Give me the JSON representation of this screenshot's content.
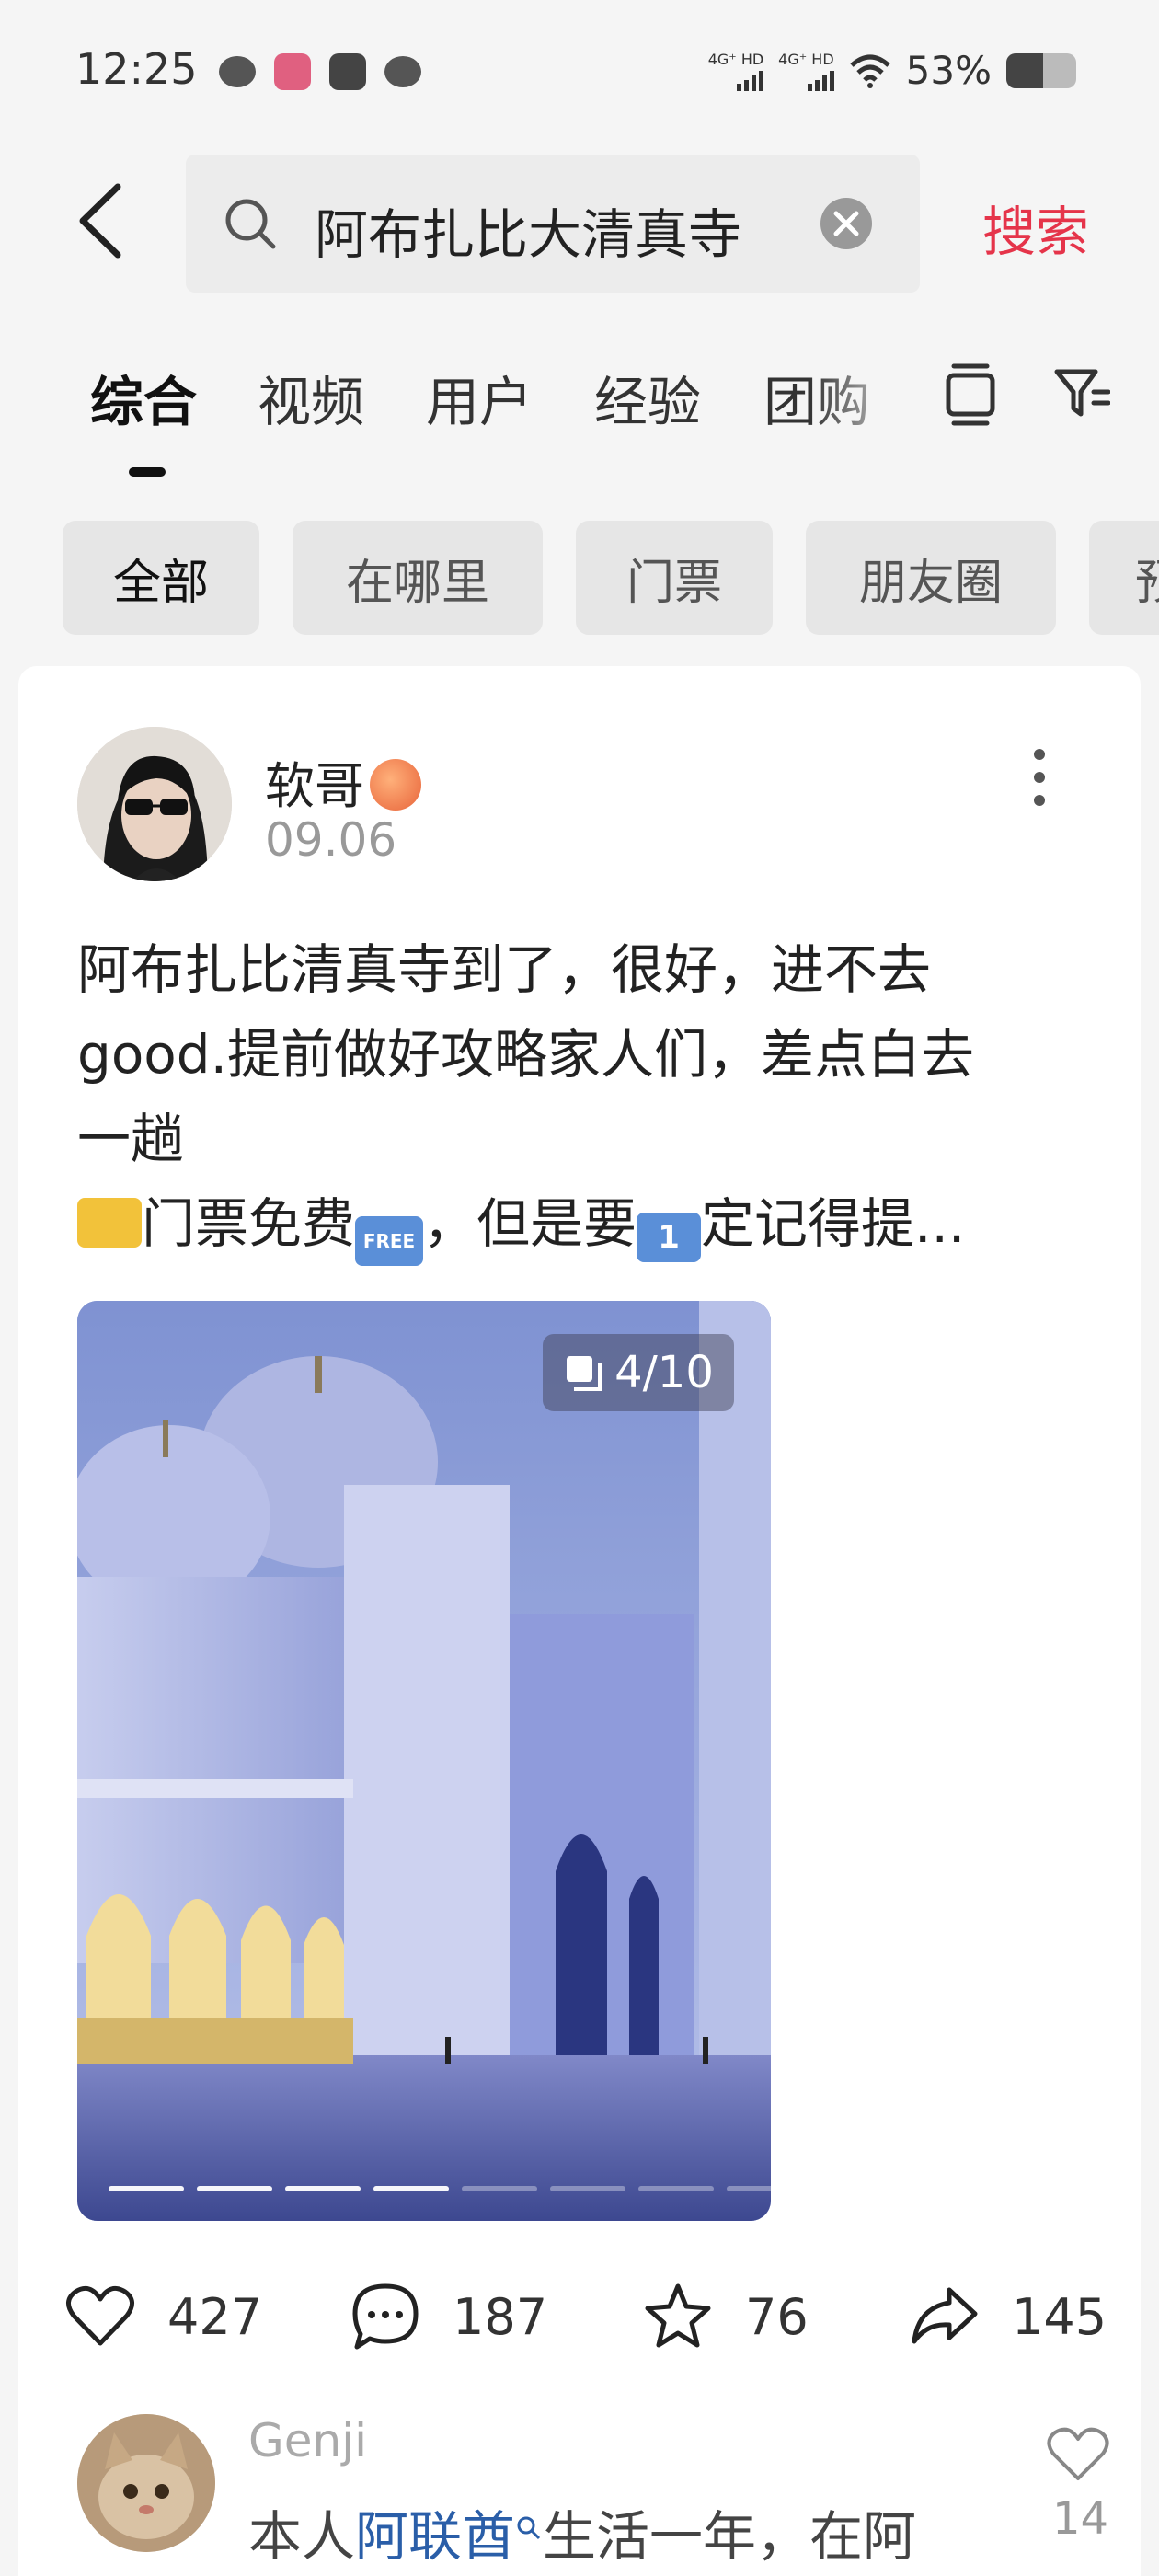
{
  "status_bar": {
    "time": "12:25",
    "network_1": "4G⁺ HD",
    "network_2": "4G⁺ HD",
    "battery_percent": "53%",
    "battery_level": 0.53,
    "left_icons": [
      "wechat-icon",
      "bilibili-icon",
      "box-icon",
      "message-icon"
    ]
  },
  "search": {
    "query": "阿布扎比大清真寺",
    "submit_label": "搜索"
  },
  "tabs": [
    {
      "label": "综合",
      "active": true
    },
    {
      "label": "视频",
      "active": false
    },
    {
      "label": "用户",
      "active": false
    },
    {
      "label": "经验",
      "active": false
    },
    {
      "label": "团购",
      "active": false
    }
  ],
  "chips": [
    {
      "label": "全部",
      "active": true
    },
    {
      "label": "在哪里",
      "active": false
    },
    {
      "label": "门票",
      "active": false
    },
    {
      "label": "朋友圈",
      "active": false
    },
    {
      "label": "预",
      "active": false
    }
  ],
  "post": {
    "author": "软哥",
    "date": "09.06",
    "text_line_1": "阿布扎比清真寺到了，很好，进不去",
    "text_line_2": "good.提前做好攻略家人们，差点白去",
    "text_line_3": "一趟",
    "text_line_4a": "门票免费",
    "text_line_4b": "，但是要",
    "text_line_4c": "定记得提...",
    "free_badge": "FREE",
    "one_badge": "1",
    "image_counter": "4/10",
    "image_index": 4,
    "image_total": 10,
    "likes": "427",
    "comments": "187",
    "favorites": "76",
    "shares": "145"
  },
  "top_comment": {
    "user": "Genji",
    "text_prefix": "本人",
    "link_text": "阿联酋",
    "text_suffix": "生活一年，在阿",
    "likes": "14"
  },
  "colors": {
    "accent": "#e5344a",
    "link": "#2a5ea8",
    "background": "#f5f5f5"
  }
}
